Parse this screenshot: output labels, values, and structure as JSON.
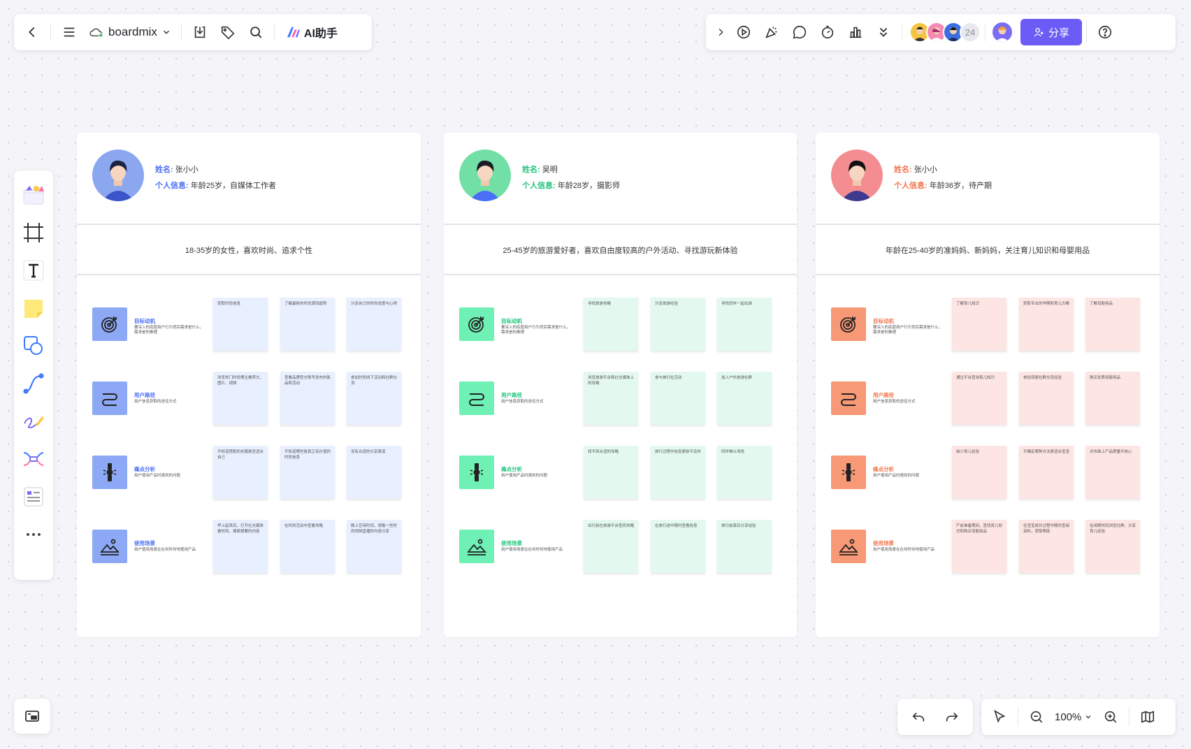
{
  "toolbar": {
    "file_name": "boardmix",
    "ai_label": "AI助手",
    "share_label": "分享",
    "collaborator_count": "24"
  },
  "zoom": {
    "level": "100%"
  },
  "colors": {
    "accent": "#6b5cf6",
    "blue_icon": "#8da8f5",
    "blue_note": "#e8efff",
    "green_icon": "#6ff0b4",
    "green_note": "#e3f9ef",
    "orange_icon": "#f79876",
    "orange_note": "#fde5e3"
  },
  "personas": [
    {
      "name_label": "姓名:",
      "name": "张小小",
      "info_label": "个人信息:",
      "info": "年龄25岁，自媒体工作者",
      "description": "18-35岁的女性，喜欢时尚、追求个性",
      "rows": [
        {
          "icon": "target-icon",
          "title": "目标动机",
          "subtitle": "要深入的底层用户行为背后需求是什么，需求是的推理",
          "notes": [
            "获取时尚信息",
            "了解最新的时尚潮流趋势",
            "分享自己的时尚态度与心得"
          ]
        },
        {
          "icon": "path-icon",
          "title": "用户路径",
          "subtitle": "用户信息获取的途径方式",
          "notes": [
            "浏览热门时尚博主推荐文、图片、视频",
            "查看品牌官方账号发布的新品和活动",
            "参加时尚线下活动和社群交流"
          ]
        },
        {
          "icon": "pain-icon",
          "title": "痛点分析",
          "subtitle": "用户使用产品时遇到的问题",
          "notes": [
            "不知道搭配的衣服是否适合自己",
            "不知道哪些是真正有价值的时尚信息",
            "没有合适的分享渠道"
          ]
        },
        {
          "icon": "scene-icon",
          "title": "使用场景",
          "subtitle": "用户使用场景在在何时何地使用产品",
          "notes": [
            "早上起来后，打开社交媒体看时尚、搜索想要的内容",
            "在时尚活动中查看攻略",
            "晚上空闲时间，观看一些时尚视频直播的内容分享"
          ]
        }
      ]
    },
    {
      "name_label": "姓名:",
      "name": "吴明",
      "info_label": "个人信息:",
      "info": "年龄28岁，摄影师",
      "description": "25-45岁的旅游爱好者，喜欢自由度较高的户外活动、寻找游玩新体验",
      "rows": [
        {
          "icon": "target-icon",
          "title": "目标动机",
          "subtitle": "要深入的底层用户行为背后需求是什么，需求是的推理",
          "notes": [
            "寻找旅游攻略",
            "分享旅游经验",
            "寻找同伴一起出游"
          ]
        },
        {
          "icon": "path-icon",
          "title": "用户路径",
          "subtitle": "用户信息获取的途径方式",
          "notes": [
            "浏览旅游平台和社交媒体上的攻略",
            "参与旅行社活动",
            "加入户外旅游社群"
          ]
        },
        {
          "icon": "pain-icon",
          "title": "痛点分析",
          "subtitle": "用户使用产品时遇到的问题",
          "notes": [
            "找不到合适的攻略",
            "旅行过程中信息更新不及时",
            "同伴难以寻找"
          ]
        },
        {
          "icon": "scene-icon",
          "title": "使用场景",
          "subtitle": "用户使用场景在在何时何地使用产品",
          "notes": [
            "出行前在旅游平台查找攻略",
            "在旅行途中随时查看信息",
            "旅行结束后分享经验"
          ]
        }
      ]
    },
    {
      "name_label": "姓名:",
      "name": "张小小",
      "info_label": "个人信息:",
      "info": "年龄36岁，待产期",
      "description": "年龄在25-40岁的准妈妈、新妈妈，关注育儿知识和母婴用品",
      "rows": [
        {
          "icon": "target-icon",
          "title": "目标动机",
          "subtitle": "要深入的底层用户行为背后需求是什么，需求是的推理",
          "notes": [
            "了解育儿知识",
            "获取专业的孕期和育儿方案",
            "了解母婴用品"
          ]
        },
        {
          "icon": "path-icon",
          "title": "用户路径",
          "subtitle": "用户信息获取的途径方式",
          "notes": [
            "通过平台查询育儿知识",
            "参加母婴社群交流经验",
            "购买优质母婴用品"
          ]
        },
        {
          "icon": "pain-icon",
          "title": "痛点分析",
          "subtitle": "用户使用产品时遇到的问题",
          "notes": [
            "缺少育儿经验",
            "不确定哪种方法更适合宝宝",
            "对市面上产品质量不放心"
          ]
        },
        {
          "icon": "scene-icon",
          "title": "使用场景",
          "subtitle": "用户使用场景在在何时何地使用产品",
          "notes": [
            "产前准备期间，查找育儿知识和购买母婴用品",
            "在宝宝成长过程中随时查阅资料，获取帮助",
            "在闲暇时间浏览社群，分享育儿经验"
          ]
        }
      ]
    }
  ]
}
